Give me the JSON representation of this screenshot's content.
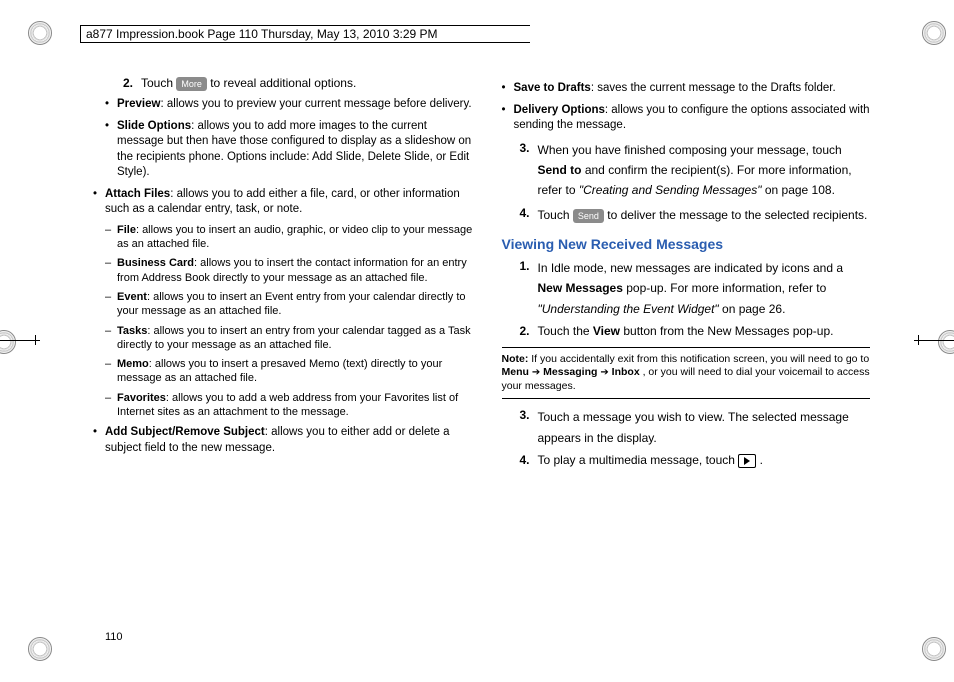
{
  "header": {
    "text": "a877 Impression.book  Page 110  Thursday, May 13, 2010  3:29 PM"
  },
  "pageNumber": "110",
  "col1": {
    "step2": {
      "num": "2.",
      "pre": "Touch ",
      "chip": "More",
      "post": " to reveal additional options."
    },
    "bullets": {
      "preview_b": "Preview",
      "preview": ": allows you to preview your current message before delivery.",
      "slide_b": "Slide Options",
      "slide": ": allows you to add more images to the current message but then have those configured to display as a slideshow on the recipients phone. Options include: Add Slide, Delete Slide, or Edit Style).",
      "attach_b": "Attach Files",
      "attach": ": allows you to add either a file, card, or other information such as a calendar entry, task, or note.",
      "subj_b": "Add Subject/Remove Subject",
      "subj": ": allows you to either add or delete a subject field to the new message."
    },
    "dashes": {
      "file_b": "File",
      "file": ": allows you to insert an audio, graphic, or video clip to your message as an attached file.",
      "bc_b": "Business Card",
      "bc": ": allows you to insert the contact information for an entry from Address Book directly to your message as an attached file.",
      "ev_b": "Event",
      "ev": ": allows you to insert an Event entry from your calendar directly to your message as an attached file.",
      "tk_b": "Tasks",
      "tk": ": allows you to insert an entry from your calendar tagged as a Task directly to your message as an attached file.",
      "me_b": "Memo",
      "me": ": allows you to insert a presaved Memo (text) directly to your message as an attached file.",
      "fv_b": "Favorites",
      "fv": ": allows you to add a web address from your Favorites list of Internet sites as an attachment to the message."
    }
  },
  "col2": {
    "bullets_top": {
      "drafts_b": "Save to Drafts",
      "drafts": ": saves the current message to the Drafts folder.",
      "deliv_b": "Delivery Options",
      "deliv": ": allows you to configure the options associated with sending the message."
    },
    "step3": {
      "num": "3.",
      "l1": "When you have finished composing your message, touch ",
      "bold": "Send to",
      "l2": " and confirm the recipient(s). For more information, refer to ",
      "ital": "\"Creating and Sending Messages\"",
      "l3": "  on page 108."
    },
    "step4": {
      "num": "4.",
      "pre": "Touch ",
      "chip": "Send",
      "post": " to deliver the message to the selected recipients."
    },
    "heading": "Viewing New Received Messages",
    "v1": {
      "num": "1.",
      "l1": "In Idle mode, new messages are indicated by icons and a ",
      "bold": "New Messages",
      "l2": " pop-up. For more information, refer to ",
      "ital": "\"Understanding the Event Widget\"",
      "l3": "  on page 26."
    },
    "v2": {
      "num": "2.",
      "l1": "Touch the ",
      "bold": "View",
      "l2": " button from the New Messages pop-up."
    },
    "note": {
      "label": "Note:",
      "t1": "If you accidentally exit from this notification screen, you will need to go to ",
      "b1": "Menu",
      "b2": "Messaging",
      "b3": "Inbox",
      "t2": ", or you will need to dial your voicemail to access your messages."
    },
    "v3": {
      "num": "3.",
      "text": "Touch a message you wish to view. The selected message appears in the display."
    },
    "v4": {
      "num": "4.",
      "text": "To play a multimedia message, touch "
    }
  }
}
